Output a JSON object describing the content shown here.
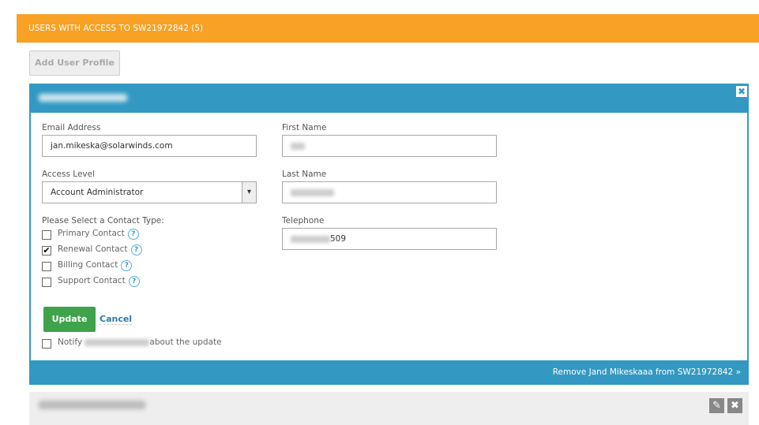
{
  "header": {
    "title": "USERS WITH ACCESS TO SW21972842 (5)"
  },
  "add_user_label": "Add User Profile",
  "panel": {
    "email_label": "Email Address",
    "email_value": "jan.mikeska@solarwinds.com",
    "access_label": "Access Level",
    "access_value": "Account Administrator",
    "first_name_label": "First Name",
    "last_name_label": "Last Name",
    "telephone_label": "Telephone",
    "telephone_suffix": "509",
    "contact_type_label": "Please Select a Contact Type:",
    "contacts": [
      {
        "label": "Primary Contact",
        "checked": false
      },
      {
        "label": "Renewal Contact",
        "checked": true
      },
      {
        "label": "Billing Contact",
        "checked": false
      },
      {
        "label": "Support Contact",
        "checked": false
      }
    ],
    "update_label": "Update",
    "cancel_label": "Cancel",
    "notify_prefix": "Notify",
    "notify_suffix": "about the update",
    "remove_label": "Remove Jand Mikeskaaa from SW21972842 »",
    "help_glyph": "?",
    "check_glyph": "✔",
    "close_glyph": "✖",
    "arrow_glyph": "▾"
  },
  "card2": {
    "edit_glyph": "✎",
    "close_glyph": "✖"
  }
}
